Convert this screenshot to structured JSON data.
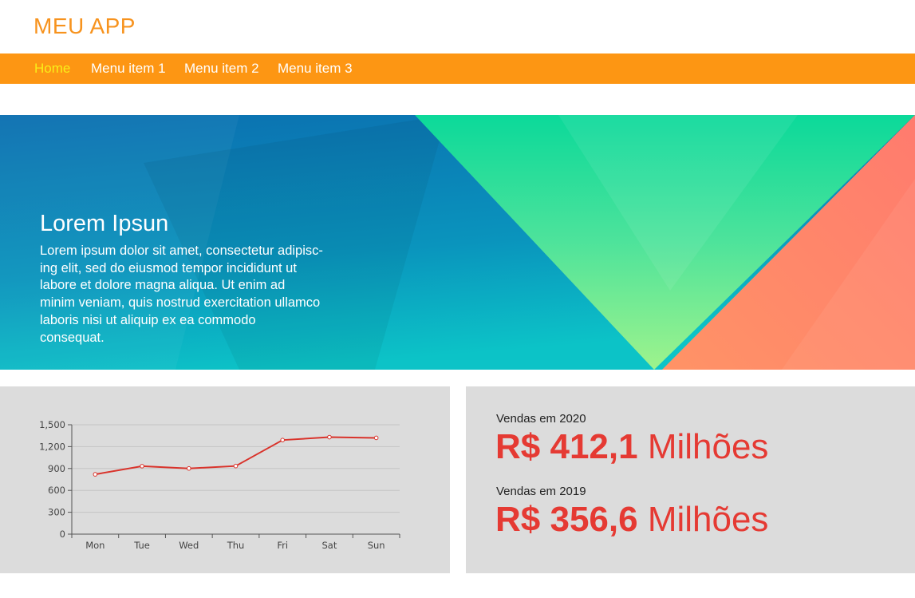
{
  "header": {
    "app_title": "MEU APP"
  },
  "nav": {
    "items": [
      {
        "label": "Home",
        "active": true
      },
      {
        "label": "Menu item 1",
        "active": false
      },
      {
        "label": "Menu item 2",
        "active": false
      },
      {
        "label": "Menu item 3",
        "active": false
      }
    ]
  },
  "hero": {
    "title": "Lorem Ipsun",
    "text": "Lorem ipsum dolor sit amet, consectetur adipisc-ing elit, sed do eiusmod tempor incididunt ut labore et dolore magna aliqua. Ut enim ad minim veniam, quis nostrud exercitation ullamco laboris nisi ut aliquip ex ea commodo consequat."
  },
  "sales": [
    {
      "label": "Vendas em 2020",
      "amount": "R$ 412,1",
      "unit": "Milhões"
    },
    {
      "label": "Vendas em 2019",
      "amount": "R$ 356,6",
      "unit": "Milhões"
    }
  ],
  "colors": {
    "nav_bg": "#fd9613",
    "nav_active": "#f9ee18",
    "accent_red": "#e53a33",
    "line_color": "#d9332b"
  },
  "chart_data": {
    "type": "line",
    "categories": [
      "Mon",
      "Tue",
      "Wed",
      "Thu",
      "Fri",
      "Sat",
      "Sun"
    ],
    "series": [
      {
        "values": [
          820,
          932,
          901,
          934,
          1290,
          1330,
          1320
        ]
      }
    ],
    "yticks": [
      "0",
      "300",
      "600",
      "900",
      "1,200",
      "1,500"
    ],
    "ylim": [
      0,
      1500
    ],
    "grid": true
  }
}
